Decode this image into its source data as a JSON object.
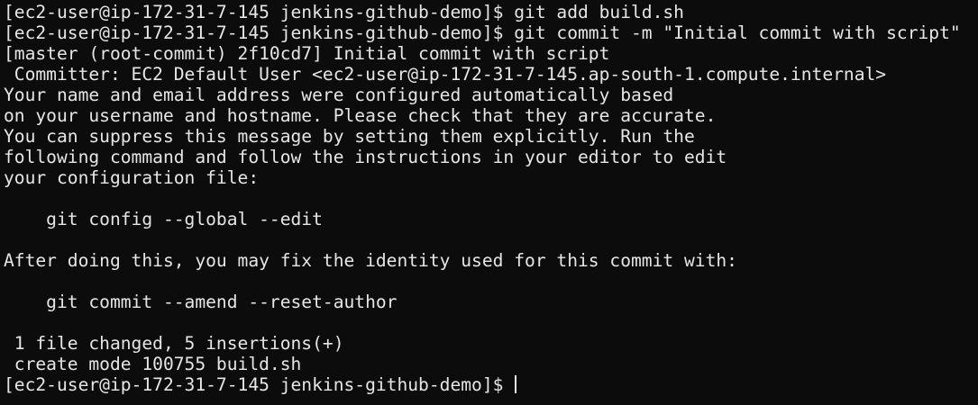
{
  "terminal": {
    "colors": {
      "background": "#0c0c0c",
      "foreground": "#e6e6e6"
    },
    "lines": [
      "[ec2-user@ip-172-31-7-145 jenkins-github-demo]$ git add build.sh",
      "[ec2-user@ip-172-31-7-145 jenkins-github-demo]$ git commit -m \"Initial commit with script\"",
      "[master (root-commit) 2f10cd7] Initial commit with script",
      " Committer: EC2 Default User <ec2-user@ip-172-31-7-145.ap-south-1.compute.internal>",
      "Your name and email address were configured automatically based",
      "on your username and hostname. Please check that they are accurate.",
      "You can suppress this message by setting them explicitly. Run the",
      "following command and follow the instructions in your editor to edit",
      "your configuration file:",
      "",
      "    git config --global --edit",
      "",
      "After doing this, you may fix the identity used for this commit with:",
      "",
      "    git commit --amend --reset-author",
      "",
      " 1 file changed, 5 insertions(+)",
      " create mode 100755 build.sh"
    ],
    "prompt": "[ec2-user@ip-172-31-7-145 jenkins-github-demo]$ "
  }
}
